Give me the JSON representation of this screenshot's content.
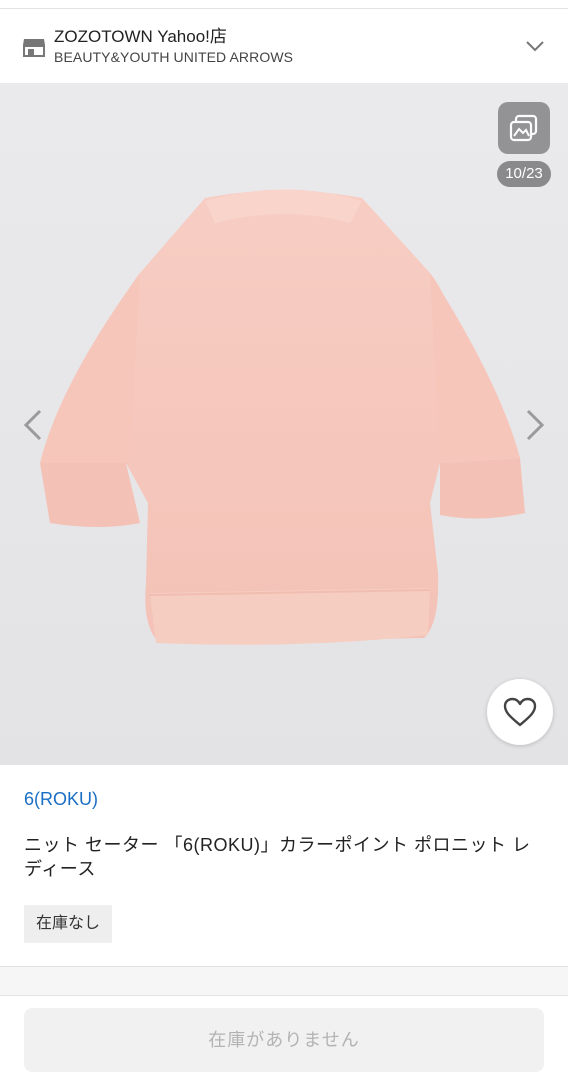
{
  "store": {
    "name": "ZOZOTOWN Yahoo!店",
    "sub": "BEAUTY&YOUTH UNITED ARROWS",
    "icon": "store-icon",
    "expand_icon": "chevron-down-icon"
  },
  "gallery": {
    "counter": "10/23",
    "current_index": 10,
    "total": 23,
    "garment_color": "#f6c7bd",
    "background_color": "#e8e8ea"
  },
  "product": {
    "brand": "6(ROKU)",
    "title": "ニット セーター 「6(ROKU)」カラーポイント ポロニット レディース",
    "stock_badge": "在庫なし",
    "link_color": "#1a6fc4"
  },
  "footer": {
    "cta_label": "在庫がありません",
    "cta_disabled": true
  }
}
